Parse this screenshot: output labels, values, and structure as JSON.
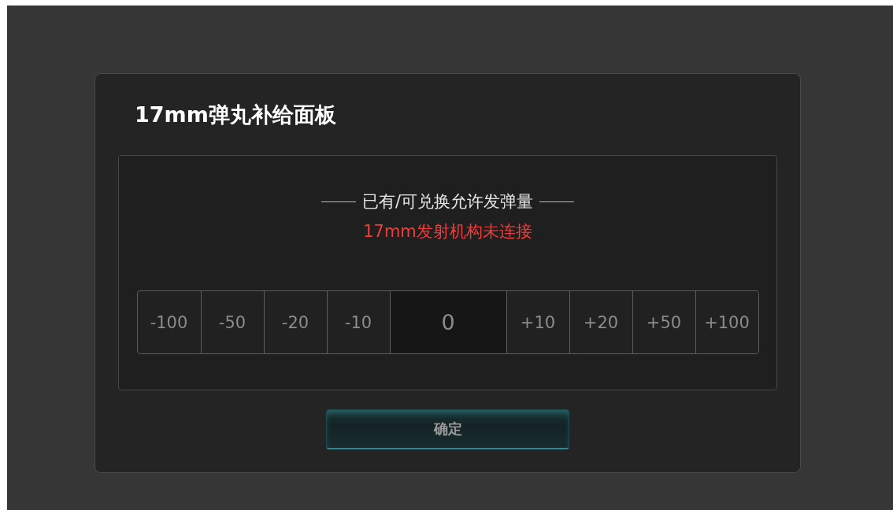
{
  "dialog": {
    "title": "17mm弹丸补给面板",
    "panel": {
      "label": "已有/可兑换允许发弹量",
      "status": "17mm发射机构未连接",
      "stepper": {
        "decrements": [
          "-100",
          "-50",
          "-20",
          "-10"
        ],
        "value": "0",
        "increments": [
          "+10",
          "+20",
          "+50",
          "+100"
        ]
      }
    },
    "confirm_button": "确定"
  }
}
